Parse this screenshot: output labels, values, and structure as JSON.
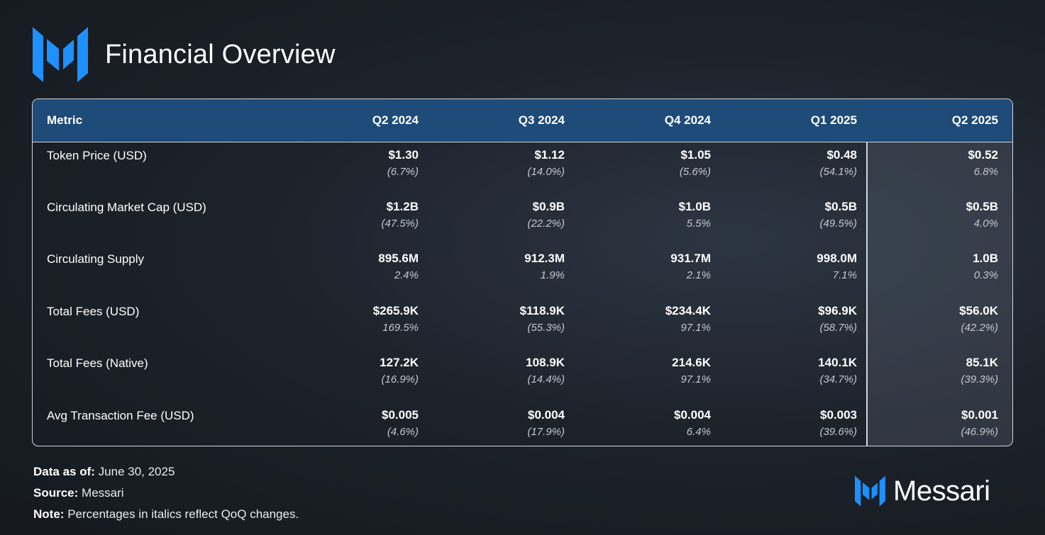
{
  "header": {
    "title": "Financial Overview",
    "logo_icon": "messari-logo-icon"
  },
  "colors": {
    "header_bg": "#1e4b78",
    "accent_blue": "#1e90ff",
    "text": "#ffffff"
  },
  "chart_data": {
    "type": "table",
    "columns": [
      "Metric",
      "Q2 2024",
      "Q3 2024",
      "Q4 2024",
      "Q1 2025",
      "Q2 2025"
    ],
    "rows": [
      {
        "metric": "Token Price (USD)",
        "values": [
          "$1.30",
          "$1.12",
          "$1.05",
          "$0.48",
          "$0.52"
        ],
        "changes": [
          "(6.7%)",
          "(14.0%)",
          "(5.6%)",
          "(54.1%)",
          "6.8%"
        ]
      },
      {
        "metric": "Circulating Market Cap (USD)",
        "values": [
          "$1.2B",
          "$0.9B",
          "$1.0B",
          "$0.5B",
          "$0.5B"
        ],
        "changes": [
          "(47.5%)",
          "(22.2%)",
          "5.5%",
          "(49.5%)",
          "4.0%"
        ]
      },
      {
        "metric": "Circulating Supply",
        "values": [
          "895.6M",
          "912.3M",
          "931.7M",
          "998.0M",
          "1.0B"
        ],
        "changes": [
          "2.4%",
          "1.9%",
          "2.1%",
          "7.1%",
          "0.3%"
        ]
      },
      {
        "metric": "Total Fees (USD)",
        "values": [
          "$265.9K",
          "$118.9K",
          "$234.4K",
          "$96.9K",
          "$56.0K"
        ],
        "changes": [
          "169.5%",
          "(55.3%)",
          "97.1%",
          "(58.7%)",
          "(42.2%)"
        ]
      },
      {
        "metric": "Total Fees (Native)",
        "values": [
          "127.2K",
          "108.9K",
          "214.6K",
          "140.1K",
          "85.1K"
        ],
        "changes": [
          "(16.9%)",
          "(14.4%)",
          "97.1%",
          "(34.7%)",
          "(39.3%)"
        ]
      },
      {
        "metric": "Avg Transaction Fee (USD)",
        "values": [
          "$0.005",
          "$0.004",
          "$0.004",
          "$0.003",
          "$0.001"
        ],
        "changes": [
          "(4.6%)",
          "(17.9%)",
          "6.4%",
          "(39.6%)",
          "(46.9%)"
        ]
      }
    ]
  },
  "footer": {
    "data_as_of_label": "Data as of:",
    "data_as_of_value": "June 30, 2025",
    "source_label": "Source:",
    "source_value": "Messari",
    "note_label": "Note:",
    "note_value": "Percentages in italics reflect QoQ changes."
  },
  "brand": {
    "name": "Messari",
    "icon": "messari-logo-icon"
  }
}
